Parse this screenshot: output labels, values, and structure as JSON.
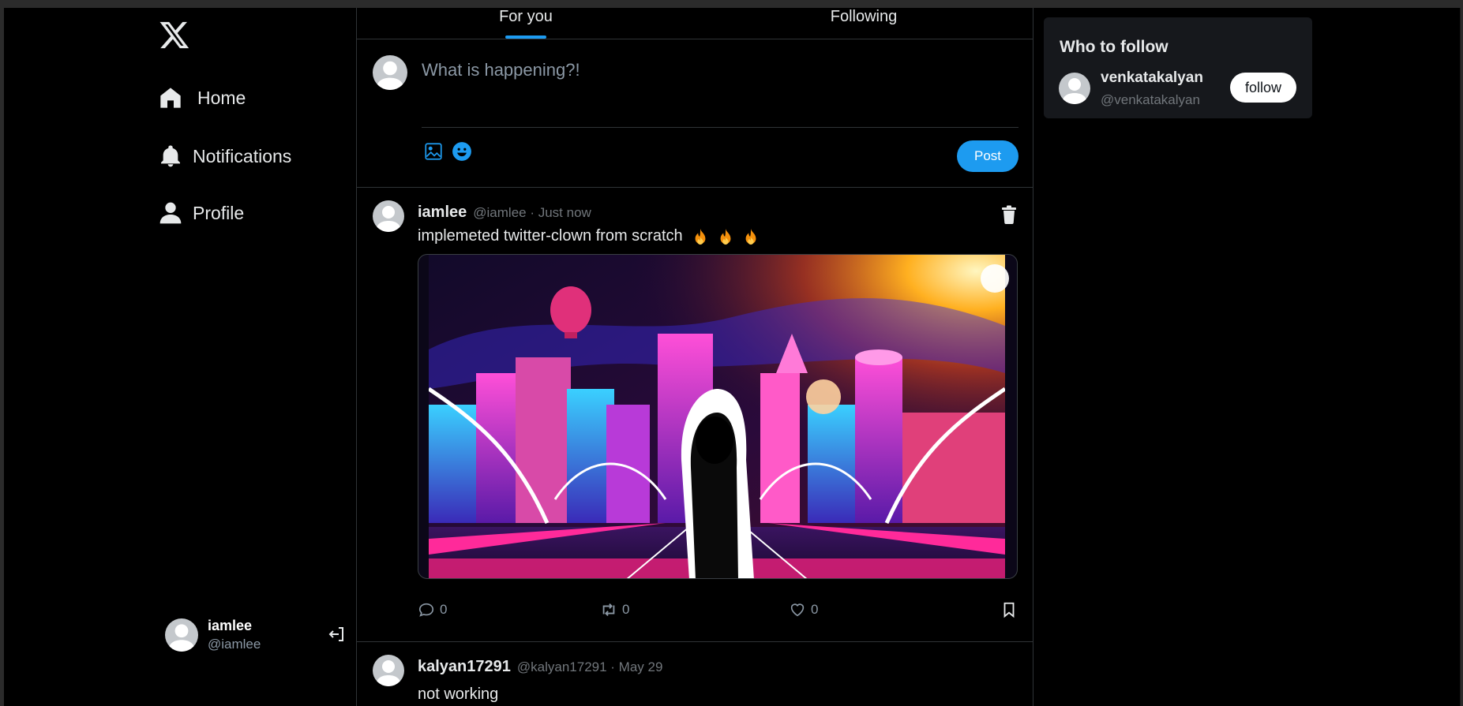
{
  "nav": {
    "home": "Home",
    "notifications": "Notifications",
    "profile": "Profile"
  },
  "account": {
    "name": "iamlee",
    "handle": "@iamlee"
  },
  "tabs": {
    "for_you": "For you",
    "following": "Following"
  },
  "composer": {
    "placeholder": "What is happening?!",
    "post_label": "Post"
  },
  "tweets": [
    {
      "name": "iamlee",
      "handle": "@iamlee",
      "meta": "@iamlee · Just now",
      "text": "implemeted twitter-clown from scratch",
      "replies": "0",
      "retweets": "0",
      "likes": "0"
    },
    {
      "name": "kalyan17291",
      "handle": "@kalyan17291",
      "meta": "@kalyan17291 · May 29",
      "text": "not working"
    }
  ],
  "who_to_follow": {
    "title": "Who to follow",
    "name": "venkatakalyan",
    "handle": "@venkatakalyan",
    "follow_label": "follow"
  },
  "colors": {
    "accent": "#1d9bf0",
    "background": "#000000",
    "card": "#16181c"
  },
  "icons": [
    "x-logo-icon",
    "home-icon",
    "bell-icon",
    "user-icon",
    "logout-icon",
    "image-icon",
    "emoji-icon",
    "trash-icon",
    "reply-icon",
    "retweet-icon",
    "heart-icon",
    "bookmark-icon",
    "scan-icon",
    "flame-icon"
  ]
}
